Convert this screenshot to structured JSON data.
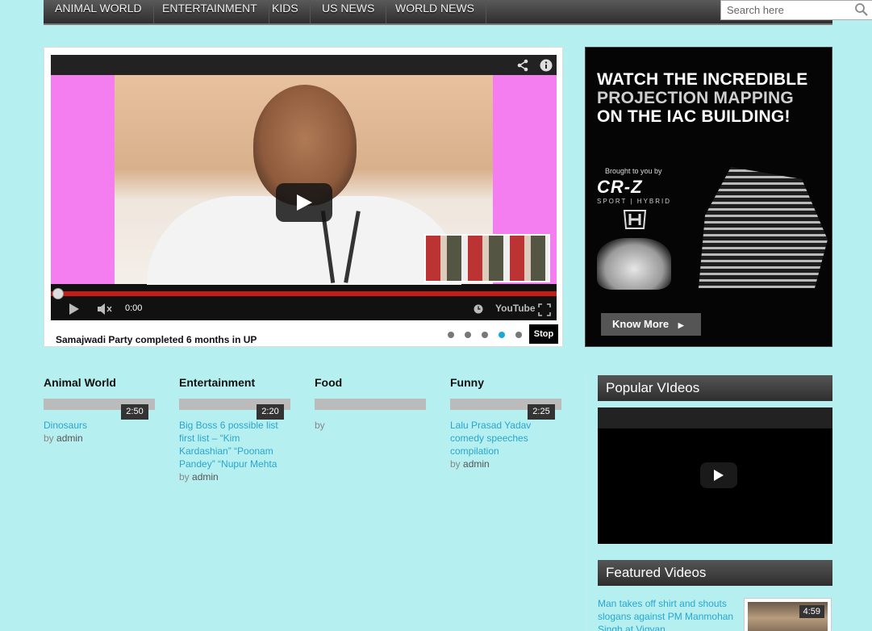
{
  "nav": {
    "items": [
      "ANIMAL WORLD",
      "ENTERTAINMENT",
      "KIDS",
      "US NEWS",
      "WORLD NEWS"
    ],
    "search_placeholder": "Search here"
  },
  "hero": {
    "time": "0:00",
    "youtube_label": "YouTube",
    "caption": "Samajwadi Party completed 6 months in UP",
    "stop_label": "Stop",
    "slide_count": 5,
    "active_slide": 4
  },
  "ad": {
    "headline_1": "WATCH THE INCREDIBLE",
    "headline_2": "PROJECTION MAPPING",
    "headline_3": "ON THE IAC BUILDING!",
    "brought_by": "Brought to you by",
    "brand": "CR-Z",
    "brand_sub": "SPORT | HYBRID",
    "button": "Know More"
  },
  "categories": [
    {
      "title": "Animal World",
      "duration": "2:50",
      "link": "Dinosaurs",
      "by": "by",
      "author": "admin"
    },
    {
      "title": "Entertainment",
      "duration": "2:20",
      "link": "Big Boss 6 possible list first list – “Kim Kardashian” “Poonam Pandey” “Nupur Mehta",
      "by": "by",
      "author": "admin"
    },
    {
      "title": "Food",
      "duration": "",
      "link": "",
      "by": "by",
      "author": ""
    },
    {
      "title": "Funny",
      "duration": "2:25",
      "link": "Lalu Prasad Yadav comedy speeches compilation",
      "by": "by",
      "author": "admin"
    }
  ],
  "widgets": {
    "popular_title": "Popular VIdeos",
    "featured_title": "Featured Videos",
    "featured_link": "Man takes off shirt and shouts slogans against PM Manmohan Singh at Vigyan",
    "featured_duration": "4:59"
  },
  "colors": {
    "page_bg": "#b5eff0",
    "link": "#2aa5cf",
    "progress": "#c51b1b",
    "active_dot": "#1aa8d6"
  }
}
